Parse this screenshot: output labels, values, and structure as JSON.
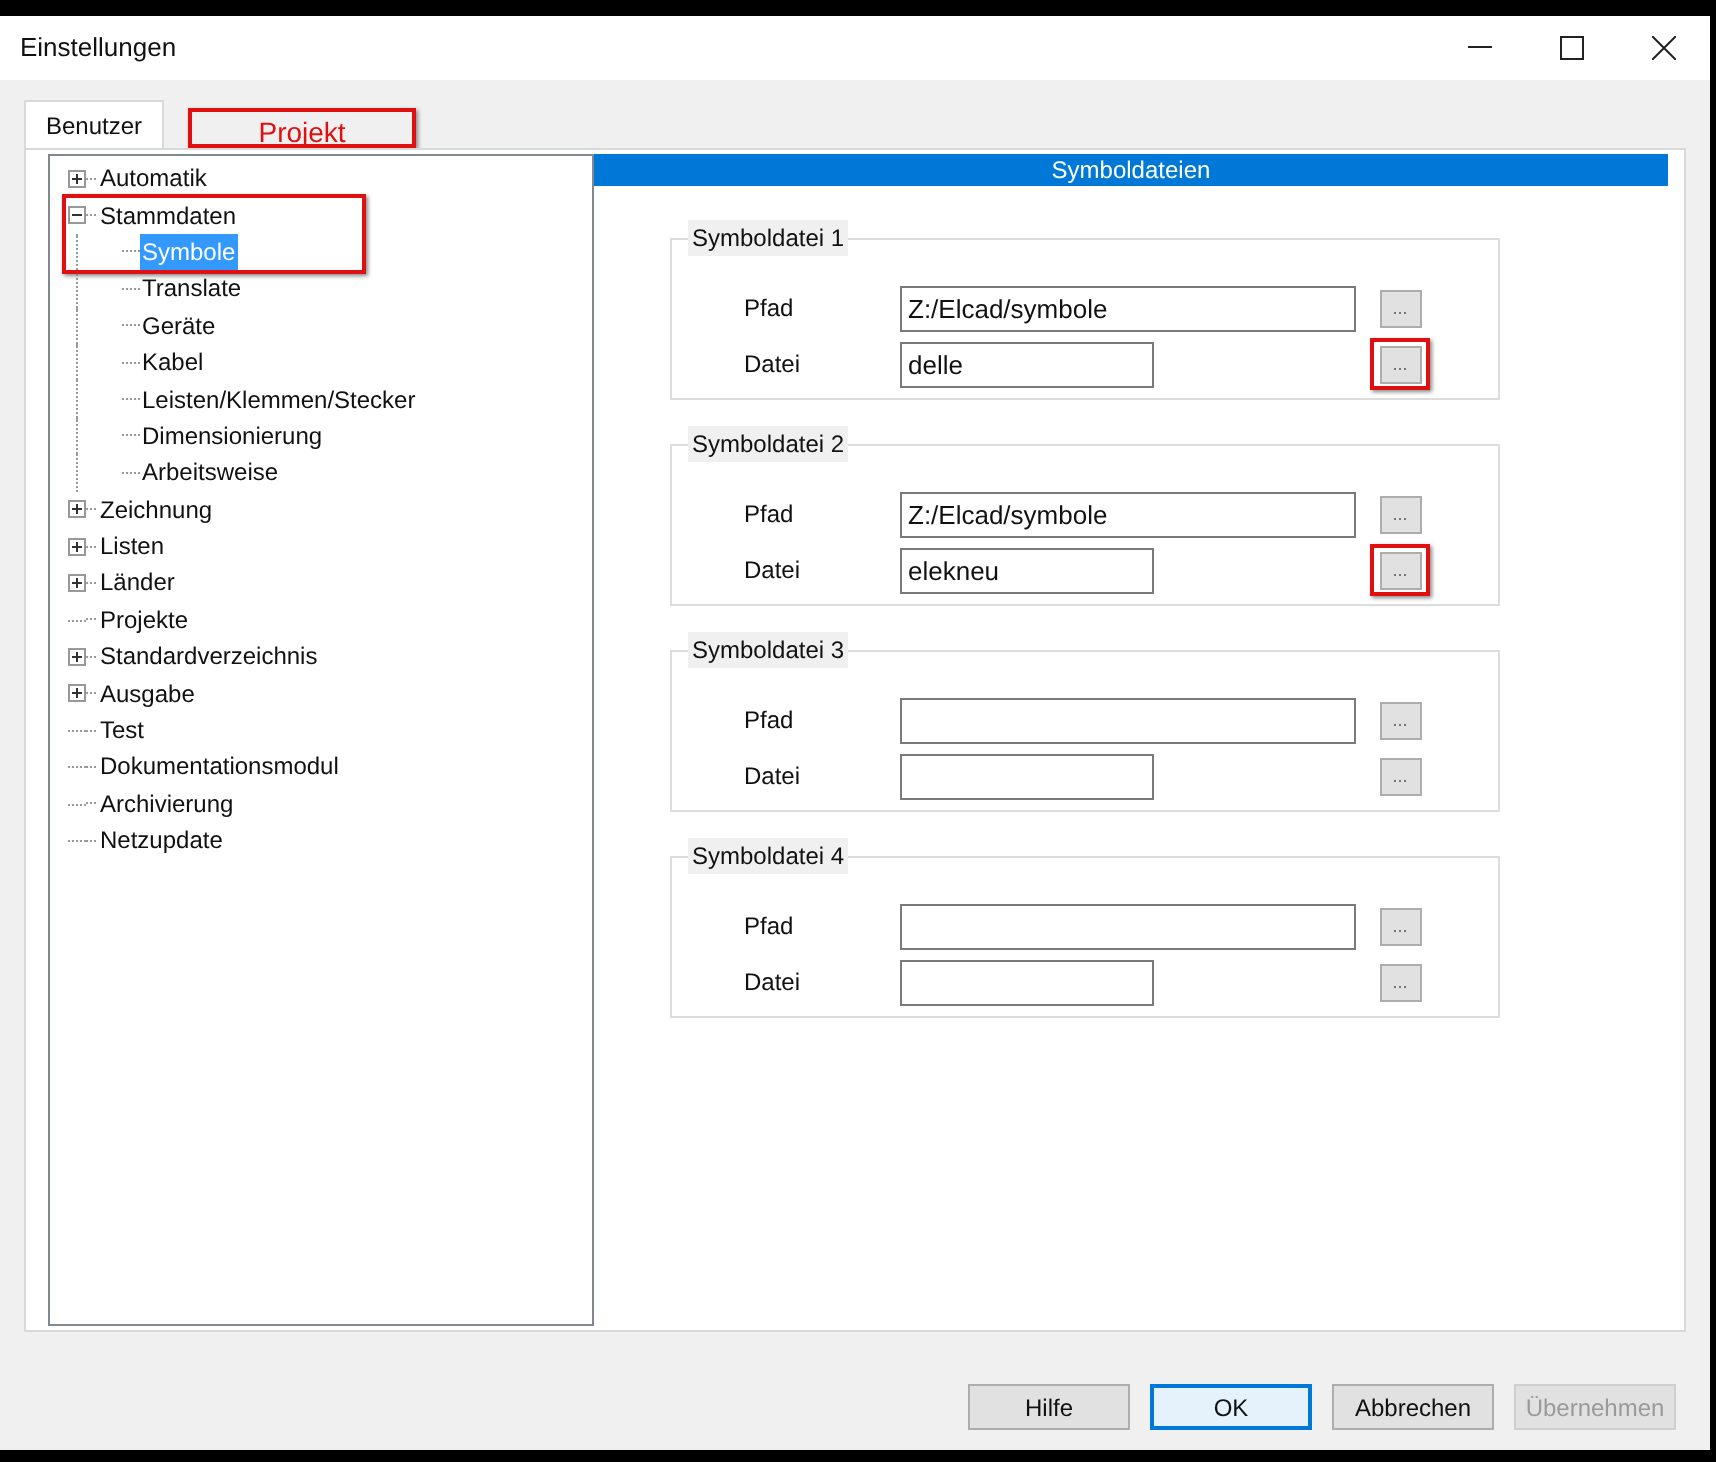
{
  "window": {
    "title": "Einstellungen"
  },
  "tabs": [
    {
      "label": "Benutzer",
      "selected": true,
      "highlighted": false
    },
    {
      "label": "Projekt",
      "selected": false,
      "highlighted": true
    }
  ],
  "tree": [
    {
      "label": "Automatik",
      "expanded": false,
      "selected": false,
      "highlighted": false
    },
    {
      "label": "Stammdaten",
      "expanded": true,
      "selected": false,
      "highlighted": true,
      "children": [
        {
          "label": "Symbole",
          "selected": true
        },
        {
          "label": "Translate",
          "selected": false
        },
        {
          "label": "Geräte",
          "selected": false
        },
        {
          "label": "Kabel",
          "selected": false
        },
        {
          "label": "Leisten/Klemmen/Stecker",
          "selected": false
        },
        {
          "label": "Dimensionierung",
          "selected": false
        },
        {
          "label": "Arbeitsweise",
          "selected": false
        }
      ]
    },
    {
      "label": "Zeichnung",
      "expanded": false,
      "selected": false,
      "highlighted": false
    },
    {
      "label": "Listen",
      "expanded": false,
      "selected": false,
      "highlighted": false
    },
    {
      "label": "Länder",
      "expanded": false,
      "selected": false,
      "highlighted": false
    },
    {
      "label": "Projekte",
      "selected": false,
      "highlighted": false
    },
    {
      "label": "Standardverzeichnis",
      "expanded": false,
      "selected": false,
      "highlighted": false
    },
    {
      "label": "Ausgabe",
      "expanded": false,
      "selected": false,
      "highlighted": false
    },
    {
      "label": "Test",
      "selected": false,
      "highlighted": false
    },
    {
      "label": "Dokumentationsmodul",
      "selected": false,
      "highlighted": false
    },
    {
      "label": "Archivierung",
      "selected": false,
      "highlighted": false
    },
    {
      "label": "Netzupdate",
      "selected": false,
      "highlighted": false
    }
  ],
  "panel": {
    "title": "Symboldateien",
    "groups": [
      {
        "title": "Symboldatei 1",
        "fields": [
          {
            "label": "Pfad",
            "value": "Z:/Elcad/symbole",
            "button": "...",
            "highlighted": false
          },
          {
            "label": "Datei",
            "value": "delle",
            "button": "...",
            "highlighted": true
          }
        ]
      },
      {
        "title": "Symboldatei 2",
        "fields": [
          {
            "label": "Pfad",
            "value": "Z:/Elcad/symbole",
            "button": "...",
            "highlighted": false
          },
          {
            "label": "Datei",
            "value": "elekneu",
            "button": "...",
            "highlighted": true
          }
        ]
      },
      {
        "title": "Symboldatei 3",
        "fields": [
          {
            "label": "Pfad",
            "button": "...",
            "highlighted": false
          },
          {
            "label": "Datei",
            "button": "...",
            "highlighted": false
          }
        ]
      },
      {
        "title": "Symboldatei 4",
        "fields": [
          {
            "label": "Pfad",
            "button": "...",
            "highlighted": false
          },
          {
            "label": "Datei",
            "button": "...",
            "highlighted": false
          }
        ]
      }
    ]
  },
  "buttons": [
    {
      "label": "Hilfe",
      "default": false,
      "disabled": false
    },
    {
      "label": "OK",
      "default": true,
      "disabled": false
    },
    {
      "label": "Abbrechen",
      "default": false,
      "disabled": false
    },
    {
      "label": "Übernehmen",
      "default": false,
      "disabled": true
    }
  ]
}
